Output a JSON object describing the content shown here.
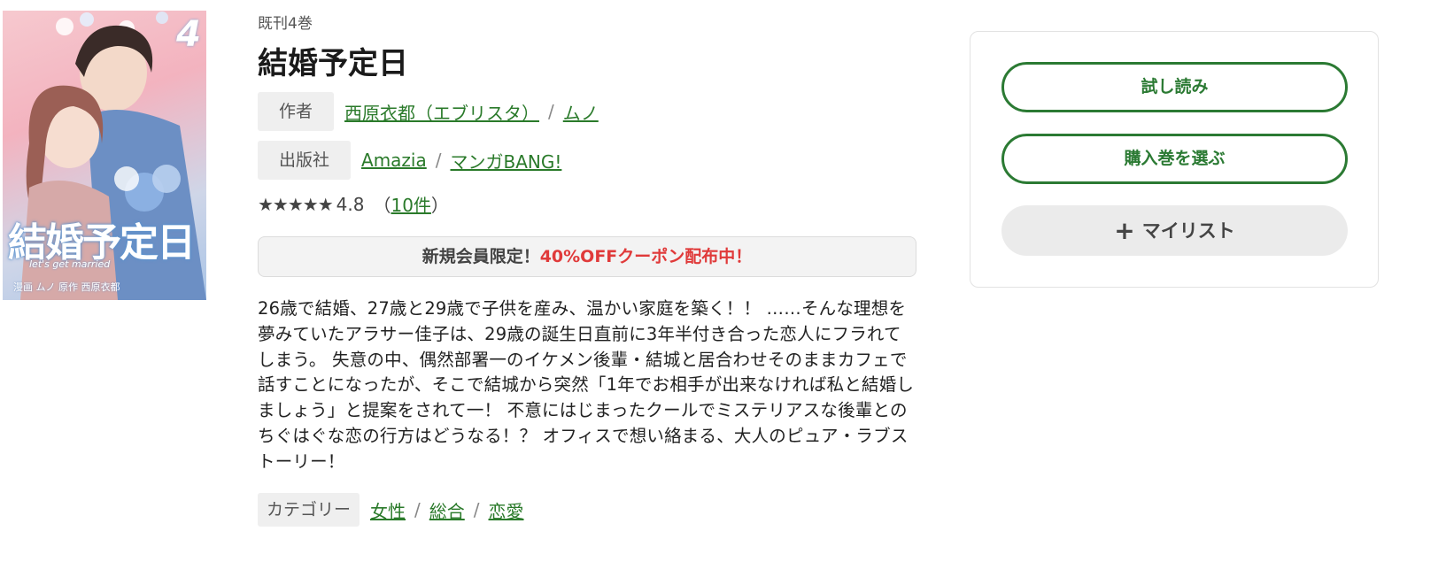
{
  "cover": {
    "volume_number": "4",
    "title_art": "結婚予定日",
    "subtitle_art": "let's get married",
    "credits_art": "漫画 ムノ  原作 西原衣都"
  },
  "book": {
    "volume_count": "既刊4巻",
    "title": "結婚予定日",
    "author_label": "作者",
    "authors": [
      "西原衣都（エブリスタ）",
      "ムノ"
    ],
    "publisher_label": "出版社",
    "publishers": [
      "Amazia",
      "マンガBANG!"
    ],
    "separator": "/",
    "rating": {
      "stars": "★★★★★",
      "score": "4.8",
      "count_open": "（",
      "count_link": "10件",
      "count_close": "）",
      "value": 4.8
    },
    "coupon": {
      "prefix": "新規会員限定！",
      "highlight": "40%OFFクーポン配布中！"
    },
    "description": "26歳で結婚、27歳と29歳で子供を産み、温かい家庭を築く！！ ……そんな理想を夢みていたアラサー佳子は、29歳の誕生日直前に3年半付き合った恋人にフラれてしまう。 失意の中、偶然部署一のイケメン後輩・結城と居合わせそのままカフェで話すことになったが、そこで結城から突然「1年でお相手が出来なければ私と結婚しましょう」と提案をされて一！ 不意にはじまったクールでミステリアスな後輩とのちぐはぐな恋の行方はどうなる！？ オフィスで想い絡まる、大人のピュア・ラブストーリー！",
    "category_label": "カテゴリー",
    "categories": [
      "女性",
      "総合",
      "恋愛"
    ]
  },
  "actions": {
    "trial_label": "試し読み",
    "purchase_label": "購入巻を選ぶ",
    "mylist_label": "マイリスト",
    "mylist_icon": "plus-icon"
  },
  "colors": {
    "accent_green": "#2b7a33",
    "coupon_red": "#e03a3a"
  }
}
